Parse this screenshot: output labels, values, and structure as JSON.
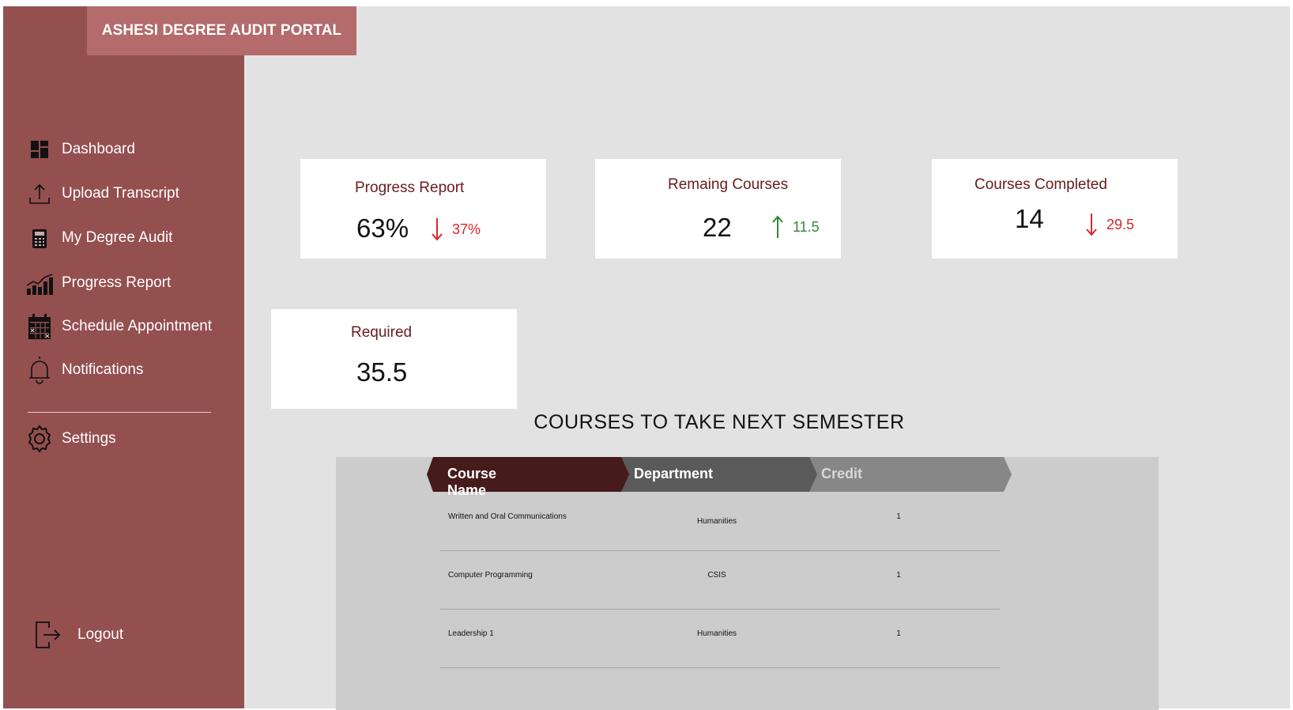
{
  "app": {
    "title": "ASHESI DEGREE AUDIT PORTAL"
  },
  "sidebar": {
    "items": [
      {
        "label": "Dashboard",
        "icon": "dashboard-icon"
      },
      {
        "label": "Upload Transcript",
        "icon": "upload-icon"
      },
      {
        "label": "My Degree Audit",
        "icon": "calculator-icon"
      },
      {
        "label": "Progress Report",
        "icon": "chart-icon"
      },
      {
        "label": "Schedule Appointment",
        "icon": "calendar-icon"
      },
      {
        "label": "Notifications",
        "icon": "bell-icon"
      }
    ],
    "settings": {
      "label": "Settings",
      "icon": "gear-icon"
    },
    "logout": {
      "label": "Logout",
      "icon": "logout-icon"
    }
  },
  "cards": {
    "progress": {
      "title": "Progress Report",
      "value": "63%",
      "delta": "37%",
      "trend": "down"
    },
    "remaining": {
      "title": "Remaing Courses",
      "value": "22",
      "delta": "11.5",
      "trend": "up"
    },
    "completed": {
      "title": "Courses Completed",
      "value": "14",
      "delta": "29.5",
      "trend": "down"
    },
    "required": {
      "title": "Required",
      "value": "35.5"
    }
  },
  "courses": {
    "title": "COURSES TO TAKE NEXT SEMESTER",
    "columns": [
      "Course Name",
      "Department",
      "Credit"
    ],
    "rows": [
      [
        "Written and Oral Communications",
        "Humanities",
        "1"
      ],
      [
        "Computer Programming",
        "CSIS",
        "1"
      ],
      [
        "Leadership 1",
        "Humanities",
        "1"
      ]
    ]
  },
  "colors": {
    "sidebar": "#944f4f",
    "brand": "#b36b6b",
    "accent_dark": "#4a1a1a",
    "down": "#d9262a",
    "up": "#2e8b2e"
  }
}
